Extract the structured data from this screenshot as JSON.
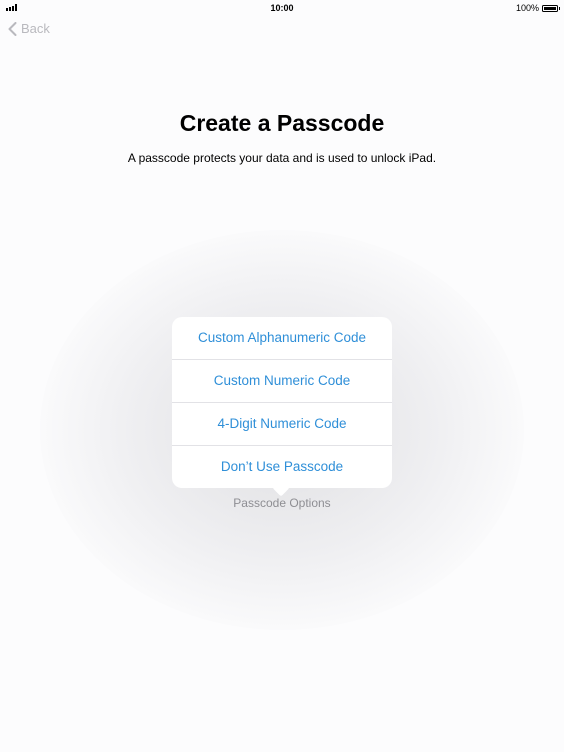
{
  "status_bar": {
    "time": "10:00",
    "battery_percent": "100%",
    "battery_level": 1.0
  },
  "nav": {
    "back_label": "Back"
  },
  "page": {
    "title": "Create a Passcode",
    "subtitle": "A passcode protects your data and is used to unlock iPad."
  },
  "popover": {
    "items": [
      {
        "label": "Custom Alphanumeric Code"
      },
      {
        "label": "Custom Numeric Code"
      },
      {
        "label": "4-Digit Numeric Code"
      },
      {
        "label": "Don’t Use Passcode"
      }
    ],
    "caption": "Passcode Options"
  },
  "colors": {
    "accent": "#2f8fd8",
    "caption": "#8e8e93",
    "back": "#b9b9be"
  },
  "icons": {
    "signal": "signal-bars-icon",
    "battery": "battery-icon",
    "back": "chevron-left-icon"
  }
}
